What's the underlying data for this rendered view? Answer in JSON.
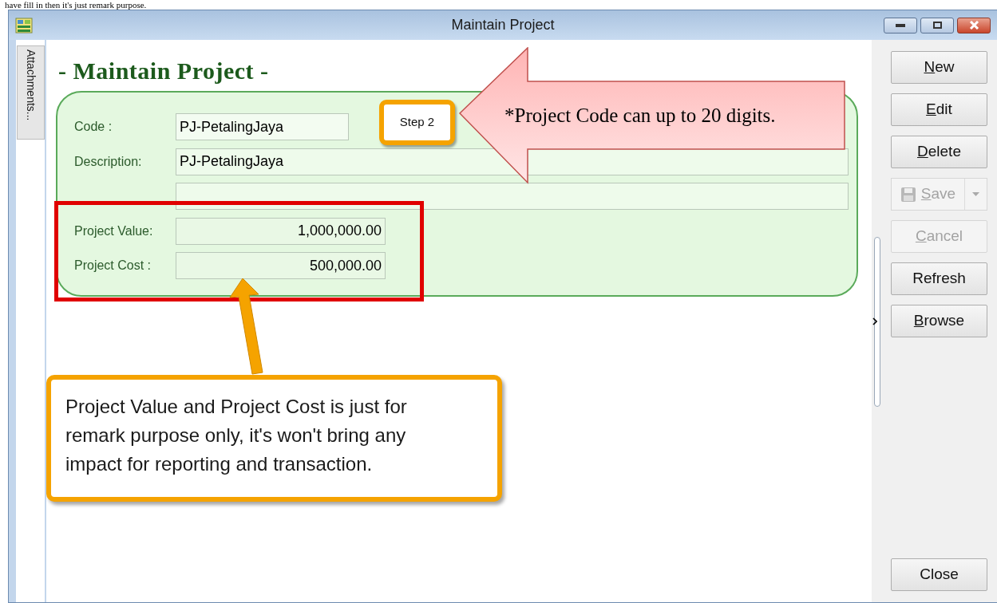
{
  "caption_fragment": "have fill in then it's just remark purpose.",
  "window": {
    "title": "Maintain Project"
  },
  "side_tab": {
    "label": "Attachments..."
  },
  "heading": "- Maintain Project -",
  "fields": [
    {
      "kind": "short",
      "label": "Code :",
      "value": "PJ-PetalingJaya"
    },
    {
      "kind": "wide",
      "label": "Description:",
      "value": "PJ-PetalingJaya"
    },
    {
      "kind": "wide"
    },
    {
      "kind": "amount",
      "label": "Project Value:",
      "value": "1,000,000.00"
    },
    {
      "kind": "amount",
      "label": "Project Cost :",
      "value": "500,000.00"
    }
  ],
  "buttons": [
    {
      "kind": "plain",
      "label": "New",
      "access_key": true,
      "disabled": false
    },
    {
      "kind": "plain",
      "label": "Edit",
      "access_key": true,
      "disabled": false
    },
    {
      "kind": "plain",
      "label": "Delete",
      "access_key": true,
      "disabled": false
    },
    {
      "kind": "split",
      "label": "Save",
      "access_key": true,
      "disabled": true
    },
    {
      "kind": "plain",
      "label": "Cancel",
      "access_key": true,
      "disabled": true
    },
    {
      "kind": "plain",
      "label": "Refresh",
      "access_key": false,
      "disabled": false
    },
    {
      "kind": "plain",
      "label": "Browse",
      "access_key": true,
      "disabled": false
    }
  ],
  "close_button": {
    "label": "Close"
  },
  "annotations": {
    "step_label": "Step 2",
    "callout": "*Project Code can up to 20 digits.",
    "note": "Project Value and Project Cost is just for remark purpose only, it's won't bring any impact for reporting and transaction."
  }
}
